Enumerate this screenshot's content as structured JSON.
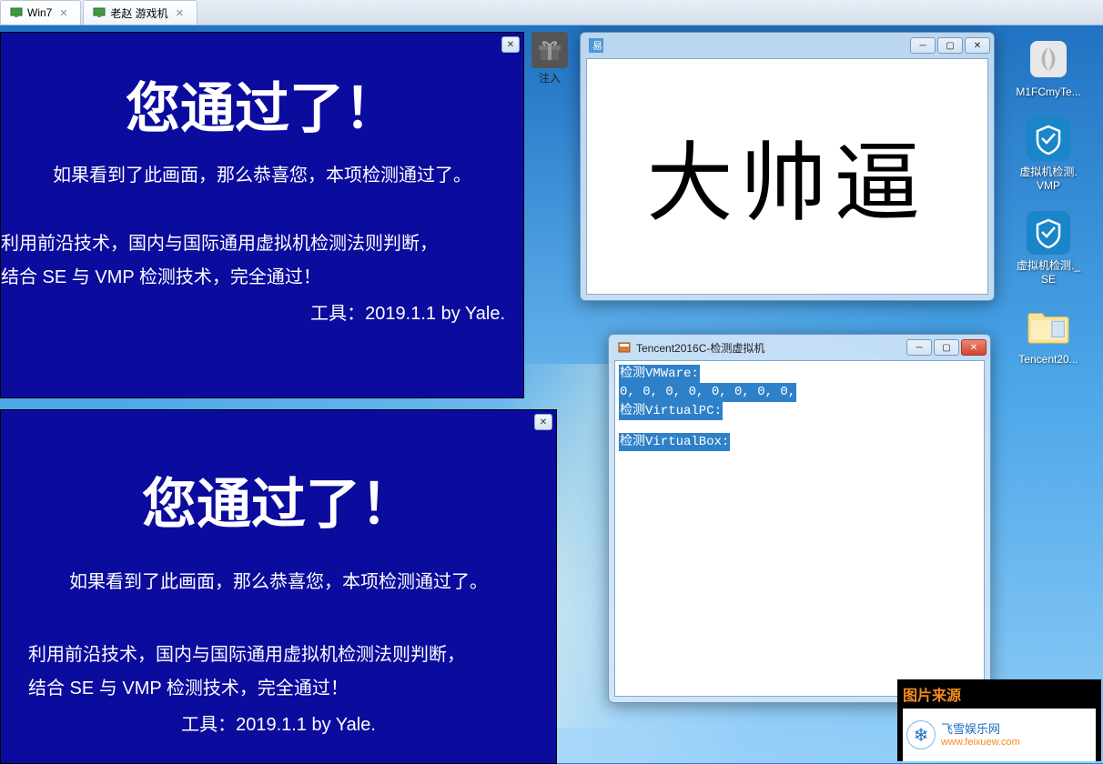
{
  "tabs": [
    {
      "label": "Win7",
      "active": true
    },
    {
      "label": "老赵 游戏机",
      "active": false
    }
  ],
  "verify": {
    "heading": "您通过了！",
    "subtitle": "如果看到了此画面，那么恭喜您，本项检测通过了。",
    "desc_line1": "利用前沿技术，国内与国际通用虚拟机检测法则判断，",
    "desc_line2": "结合 SE 与 VMP 检测技术，完全通过！",
    "toolinfo": "工具：2019.1.1  by Yale."
  },
  "inject": {
    "label": "注入"
  },
  "bigtext_window": {
    "content": "大帅逼"
  },
  "console_window": {
    "title": "Tencent2016C-检测虚拟机",
    "lines": [
      "检测VMWare:",
      "0, 0, 0, 0, 0, 0, 0, 0,",
      "检测VirtualPC:",
      "",
      "检测VirtualBox:"
    ]
  },
  "desktop_icons": [
    {
      "label": "M1FCmyTe...",
      "type": "leaf"
    },
    {
      "label": "虚拟机检测.\nVMP",
      "type": "shield"
    },
    {
      "label": "虚拟机检测._SE",
      "type": "shield"
    },
    {
      "label": "Tencent20...",
      "type": "folder"
    }
  ],
  "watermark": {
    "source_label": "图片来源",
    "brand": "飞雪娱乐网",
    "url": "www.feixuew.com"
  }
}
